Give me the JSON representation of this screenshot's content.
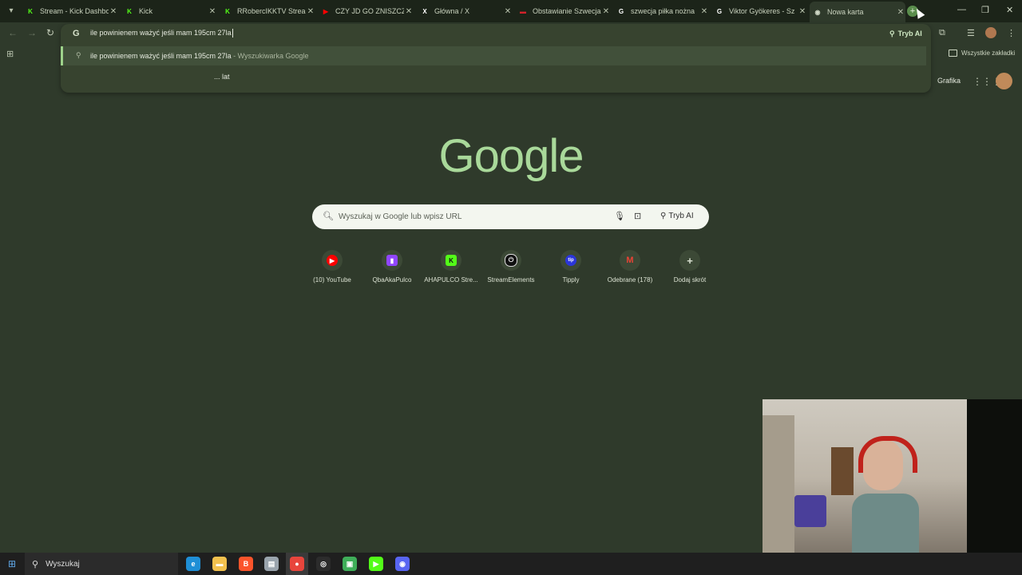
{
  "tabs": [
    {
      "title": "Stream - Kick Dashbo",
      "favicon": "kick-icon",
      "color": "#53fc18"
    },
    {
      "title": "Kick",
      "favicon": "kick-icon",
      "color": "#53fc18"
    },
    {
      "title": "RRobercIKKTV Stream",
      "favicon": "kick-icon",
      "color": "#53fc18"
    },
    {
      "title": "CZY JD GO ZNISZCZY",
      "favicon": "youtube-icon",
      "color": "#ff0000"
    },
    {
      "title": "Główna / X",
      "favicon": "x-icon",
      "color": "#ffffff"
    },
    {
      "title": "Obstawianie Szwecja",
      "favicon": "betting-icon",
      "color": "#d3222a"
    },
    {
      "title": "szwecja piłka nożna",
      "favicon": "google-icon",
      "color": "#ffffff"
    },
    {
      "title": "Viktor Gyökeres - Sz",
      "favicon": "google-icon",
      "color": "#ffffff"
    },
    {
      "title": "Nowa karta",
      "favicon": "chrome-icon",
      "color": "#cfd7c5"
    }
  ],
  "omnibox": {
    "value": "ile powinienem ważyć jeśli mam 195cm 27la",
    "suggestion_query": "ile powinienem ważyć jeśli mam 195cm 27la",
    "suggestion_source": "Wyszukiwarka Google",
    "suggestion_separator": " - ",
    "suggestion_2": "... lat",
    "ai_mode_label": "Tryb AI"
  },
  "bookmarks": {
    "all_bookmarks_label": "Wszystkie zakładki"
  },
  "google": {
    "logo": "Google",
    "images_link": "Grafika",
    "search_placeholder": "Wyszukaj w Google lub wpisz URL",
    "ai_mode_label": "Tryb AI"
  },
  "shortcuts": [
    {
      "label": "(10) YouTube",
      "icon": "youtube-icon",
      "color": "#ff0000",
      "glyph": "▶"
    },
    {
      "label": "QbaAkaPulco",
      "icon": "twitch-icon",
      "color": "#9146ff",
      "glyph": "▮"
    },
    {
      "label": "AHAPULCO Stre...",
      "icon": "kick-icon",
      "color": "#53fc18",
      "glyph": "K"
    },
    {
      "label": "StreamElements",
      "icon": "streamelements-icon",
      "color": "#111111",
      "glyph": "⏻"
    },
    {
      "label": "Tipply",
      "icon": "tipply-icon",
      "color": "#2b36d9",
      "glyph": "tip"
    },
    {
      "label": "Odebrane (178)",
      "icon": "gmail-icon",
      "color": "#ea4335",
      "glyph": "M"
    },
    {
      "label": "Dodaj skrót",
      "icon": "add-icon",
      "color": "#3c4936",
      "glyph": "+"
    }
  ],
  "taskbar": {
    "search_label": "Wyszukaj",
    "apps": [
      {
        "name": "edge-icon",
        "color": "#1f8fd6",
        "glyph": "e"
      },
      {
        "name": "file-explorer-icon",
        "color": "#f2c14e",
        "glyph": "▬"
      },
      {
        "name": "brave-icon",
        "color": "#fb542b",
        "glyph": "B"
      },
      {
        "name": "app-icon",
        "color": "#9aa4ad",
        "glyph": "▤"
      },
      {
        "name": "chrome-icon",
        "color": "#e8453c",
        "glyph": "●"
      },
      {
        "name": "obs-icon",
        "color": "#2c2c2c",
        "glyph": "◎"
      },
      {
        "name": "streaming-app-icon",
        "color": "#3fae59",
        "glyph": "▣"
      },
      {
        "name": "play-icon",
        "color": "#53fc18",
        "glyph": "▶"
      },
      {
        "name": "discord-icon",
        "color": "#5865f2",
        "glyph": "◉"
      }
    ]
  }
}
